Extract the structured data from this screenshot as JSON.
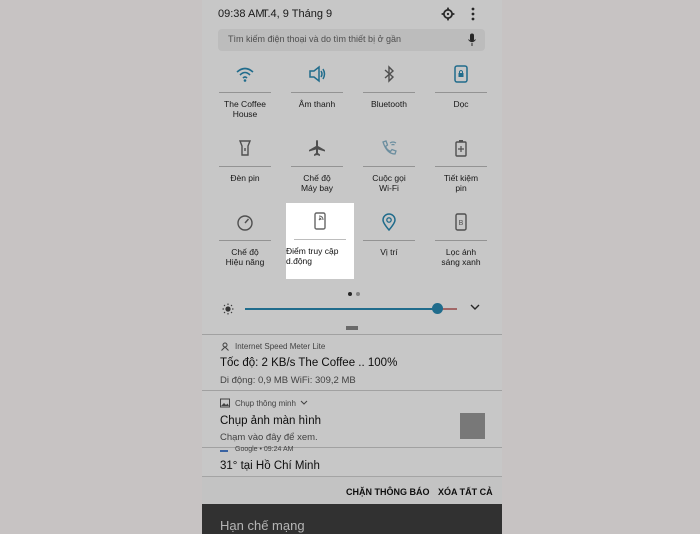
{
  "status": {
    "time": "09:38 AM",
    "date": "T.4, 9 Tháng 9"
  },
  "search": {
    "placeholder": "Tìm kiếm điện thoại và do tìm thiết bị ở gần"
  },
  "tiles": [
    {
      "label1": "The Coffee",
      "label2": "House",
      "icon": "wifi-icon"
    },
    {
      "label1": "Âm thanh",
      "label2": "",
      "icon": "volume-icon"
    },
    {
      "label1": "Bluetooth",
      "label2": "",
      "icon": "bluetooth-icon"
    },
    {
      "label1": "Dọc",
      "label2": "",
      "icon": "rotation-lock-icon"
    },
    {
      "label1": "Đèn pin",
      "label2": "",
      "icon": "flashlight-icon"
    },
    {
      "label1": "Chế độ",
      "label2": "Máy bay",
      "icon": "airplane-icon"
    },
    {
      "label1": "Cuộc gọi",
      "label2": "Wi-Fi",
      "icon": "wifi-call-icon"
    },
    {
      "label1": "Tiết kiệm",
      "label2": "pin",
      "icon": "battery-saver-icon"
    },
    {
      "label1": "Chế độ",
      "label2": "Hiệu năng",
      "icon": "performance-icon"
    },
    {
      "label1": "Điểm truy cập",
      "label2": "d.động",
      "icon": "hotspot-icon"
    },
    {
      "label1": "Vị trí",
      "label2": "",
      "icon": "location-icon"
    },
    {
      "label1": "Lọc ánh",
      "label2": "sáng xanh",
      "icon": "blue-light-filter-icon"
    }
  ],
  "brightness": {
    "level": 0.93
  },
  "notifications": {
    "speed": {
      "app": "Internet Speed Meter Lite",
      "title": "Tốc độ: 2 KB/s   The Coffee .. 100%",
      "detail": "Di động: 0,9 MB   WiFi: 309,2 MB"
    },
    "screenshot": {
      "app": "Chụp thông minh",
      "title": "Chụp ảnh màn hình",
      "body": "Chạm vào đây để xem."
    },
    "weather": {
      "app": "Google • 09:24 AM",
      "title": "31° tại Hồ Chí Minh"
    }
  },
  "actions": {
    "block": "CHẶN THÔNG BÁO",
    "clear": "XÓA TẤT CẢ"
  },
  "bottom": {
    "text": "Hạn chế mạng"
  },
  "colors": {
    "accent": "#2a8bb4",
    "background": "#c7c3c3"
  }
}
